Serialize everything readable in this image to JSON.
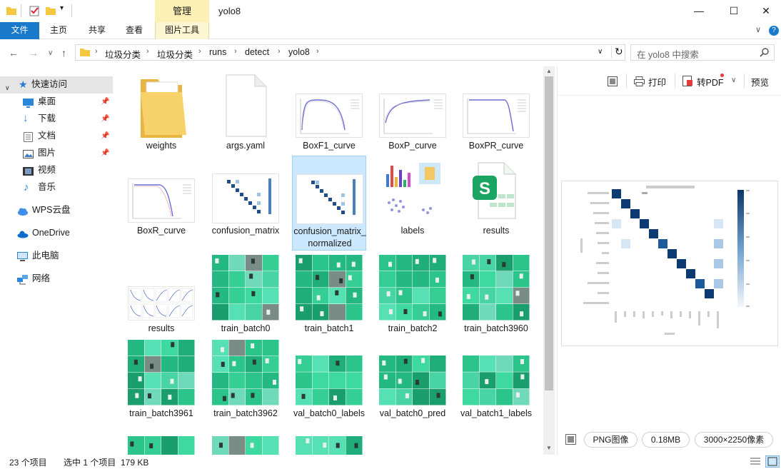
{
  "title_bar": {
    "manage_tab": "管理",
    "window_title": "yolo8",
    "minimize": "—",
    "maximize": "☐",
    "close": "✕"
  },
  "ribbon": {
    "tabs": [
      "文件",
      "主页",
      "共享",
      "查看",
      "图片工具"
    ],
    "collapse": "∨",
    "help": "?"
  },
  "address": {
    "back": "←",
    "forward": "→",
    "recent": "∨",
    "up": "↑",
    "crumbs": [
      "垃圾分类",
      "垃圾分类",
      "runs",
      "detect",
      "yolo8"
    ],
    "dropdown": "∨",
    "refresh": "↻",
    "search_placeholder": "在 yolo8 中搜索"
  },
  "nav": {
    "items": [
      {
        "label": "快速访问",
        "icon": "star-icon"
      },
      {
        "label": "桌面",
        "icon": "desktop-icon"
      },
      {
        "label": "下载",
        "icon": "download-icon"
      },
      {
        "label": "文档",
        "icon": "document-icon"
      },
      {
        "label": "图片",
        "icon": "picture-icon"
      },
      {
        "label": "视频",
        "icon": "video-icon"
      },
      {
        "label": "音乐",
        "icon": "music-icon"
      },
      {
        "label": "WPS云盘",
        "icon": "cloud-icon"
      },
      {
        "label": "OneDrive",
        "icon": "onedrive-icon"
      },
      {
        "label": "此电脑",
        "icon": "computer-icon"
      },
      {
        "label": "网络",
        "icon": "network-icon"
      }
    ]
  },
  "files": [
    {
      "name": "weights",
      "type": "folder"
    },
    {
      "name": "args.yaml",
      "type": "file"
    },
    {
      "name": "BoxF1_curve",
      "type": "curve"
    },
    {
      "name": "BoxP_curve",
      "type": "curve"
    },
    {
      "name": "BoxPR_curve",
      "type": "curve"
    },
    {
      "name": "BoxR_curve",
      "type": "curve"
    },
    {
      "name": "confusion_matrix",
      "type": "matrix"
    },
    {
      "name": "confusion_matrix_normalized",
      "type": "matrix",
      "selected": true
    },
    {
      "name": "labels",
      "type": "labels"
    },
    {
      "name": "results",
      "type": "xlsx"
    },
    {
      "name": "results",
      "type": "results"
    },
    {
      "name": "train_batch0",
      "type": "batch"
    },
    {
      "name": "train_batch1",
      "type": "batch"
    },
    {
      "name": "train_batch2",
      "type": "batch"
    },
    {
      "name": "train_batch3960",
      "type": "batch"
    },
    {
      "name": "train_batch3961",
      "type": "batch"
    },
    {
      "name": "train_batch3962",
      "type": "batch"
    },
    {
      "name": "val_batch0_labels",
      "type": "batch"
    },
    {
      "name": "val_batch0_pred",
      "type": "batch"
    },
    {
      "name": "val_batch1_labels",
      "type": "batch"
    }
  ],
  "preview": {
    "print": "打印",
    "to_pdf": "转PDF",
    "preview": "预览",
    "format": "PNG图像",
    "size": "0.18MB",
    "dimensions": "3000×2250像素"
  },
  "status": {
    "count": "23 个项目",
    "selection": "选中 1 个项目  179 KB"
  },
  "colors": {
    "accent": "#1979ca",
    "selection": "#cce8ff",
    "manage": "#fcf0b4",
    "nav_selected": "#e5e5e5"
  }
}
